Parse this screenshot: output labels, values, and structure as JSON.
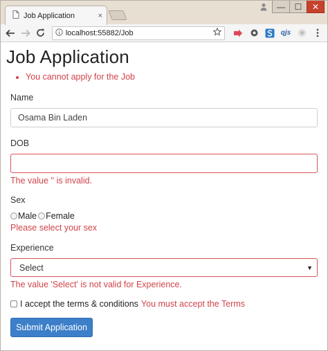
{
  "browser": {
    "tab_title": "Job Application",
    "tab_close": "×",
    "url": "localhost:55882/Job",
    "extensions": [
      "qjs"
    ],
    "window_controls": {
      "minimize": "—",
      "maximize": "☐",
      "close": "✕"
    }
  },
  "page": {
    "title": "Job Application",
    "summary_errors": [
      "You cannot apply for the Job"
    ],
    "name": {
      "label": "Name",
      "value": "Osama Bin Laden"
    },
    "dob": {
      "label": "DOB",
      "value": "",
      "error": "The value '' is invalid."
    },
    "sex": {
      "label": "Sex",
      "options": [
        "Male",
        "Female"
      ],
      "error": "Please select your sex"
    },
    "experience": {
      "label": "Experience",
      "selected": "Select",
      "error": "The value 'Select' is not valid for Experience."
    },
    "terms": {
      "label": "I accept the terms & conditions",
      "error": "You must accept the Terms"
    },
    "submit_label": "Submit Application"
  },
  "colors": {
    "error": "#d0444a",
    "primary_button": "#3d7fc9",
    "invalid_border": "#d9535a"
  }
}
